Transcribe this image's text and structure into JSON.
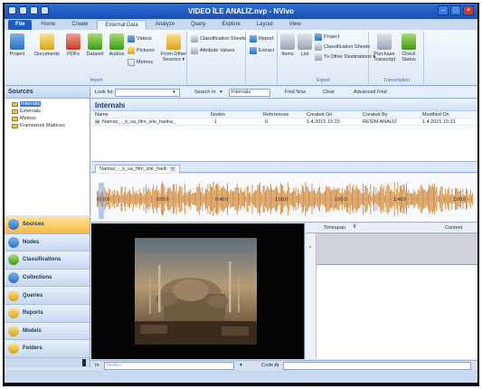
{
  "window": {
    "title": "VIDEO İLE ANALİZ.nvp - NVivo"
  },
  "ribbon_tabs": [
    {
      "label": "File"
    },
    {
      "label": "Home"
    },
    {
      "label": "Create"
    },
    {
      "label": "External Data"
    },
    {
      "label": "Analyze"
    },
    {
      "label": "Query"
    },
    {
      "label": "Explore"
    },
    {
      "label": "Layout"
    },
    {
      "label": "View"
    }
  ],
  "active_tab": "External Data",
  "ribbon": {
    "project_label": "Project",
    "documents_label": "Documents",
    "pdfs_label": "PDFs",
    "dataset_label": "Dataset",
    "audios_label": "Audios",
    "videos_label": "Videos",
    "pictures_label": "Pictures",
    "memos_label": "Memos",
    "from_other_sources_label": "From Other Sources ▾",
    "import_group": "Import",
    "classification_sheets_label": "Classification Sheets",
    "attribute_values_label": "Attribute Values",
    "report_label": "Report",
    "extract_label": "Extract",
    "items_label": "Items",
    "list_label": "List",
    "export_project_label": "Project",
    "export_classification_label": "Classification Sheets",
    "to_other_destinations_label": "To Other Destinations ▾",
    "export_group": "Export",
    "purchase_transcript_label": "Purchase Transcript",
    "check_status_label": "Check Status",
    "transcription_group": "Transcription"
  },
  "sources_panel": {
    "title": "Sources",
    "items": [
      {
        "label": "Internals",
        "selected": true
      },
      {
        "label": "Externals"
      },
      {
        "label": "Memos"
      },
      {
        "label": "Framework Matrices"
      }
    ]
  },
  "nav_buttons": [
    {
      "label": "Sources",
      "active": true
    },
    {
      "label": "Nodes"
    },
    {
      "label": "Classifications"
    },
    {
      "label": "Collections"
    },
    {
      "label": "Queries"
    },
    {
      "label": "Reports"
    },
    {
      "label": "Models"
    },
    {
      "label": "Folders"
    }
  ],
  "findbar": {
    "look_for_label": "Look for:",
    "look_for_value": "",
    "search_in_label": "Search In",
    "search_in_value": "Internals",
    "find_now_label": "Find Now",
    "clear_label": "Clear",
    "advanced_find_label": "Advanced Find"
  },
  "list_view": {
    "title": "Internals",
    "columns": [
      "Name",
      "Nodes",
      "References",
      "Created On",
      "Created By",
      "Modified On"
    ],
    "rows": [
      {
        "name": "Namaz_-_k_sa_film_izle_harika_",
        "nodes": "1",
        "references": "6",
        "created_on": "1.4.2015 15:23",
        "created_by": "RESİM ANALİZ",
        "modified_on": "1.4.2015 15:31"
      }
    ]
  },
  "media_tab": {
    "label": "Namaz_-_k_sa_film_izle_harik"
  },
  "waveform": {
    "tick_labels": [
      "0:00.0",
      "0:20.0",
      "0:40.0",
      "1:00.0",
      "1:20.0",
      "1:40.0",
      "2:00.0"
    ]
  },
  "transcript": {
    "columns": [
      "Timespan",
      "Content"
    ],
    "row_marker": "*"
  },
  "statusbar": {
    "in_label": "In",
    "in_value": "Nodes",
    "code_at_label": "Code At",
    "code_at_value": ""
  },
  "colors": {
    "accent": "#1d5bc3",
    "waveform": "#d4893a",
    "active_nav": "#f7b845"
  }
}
